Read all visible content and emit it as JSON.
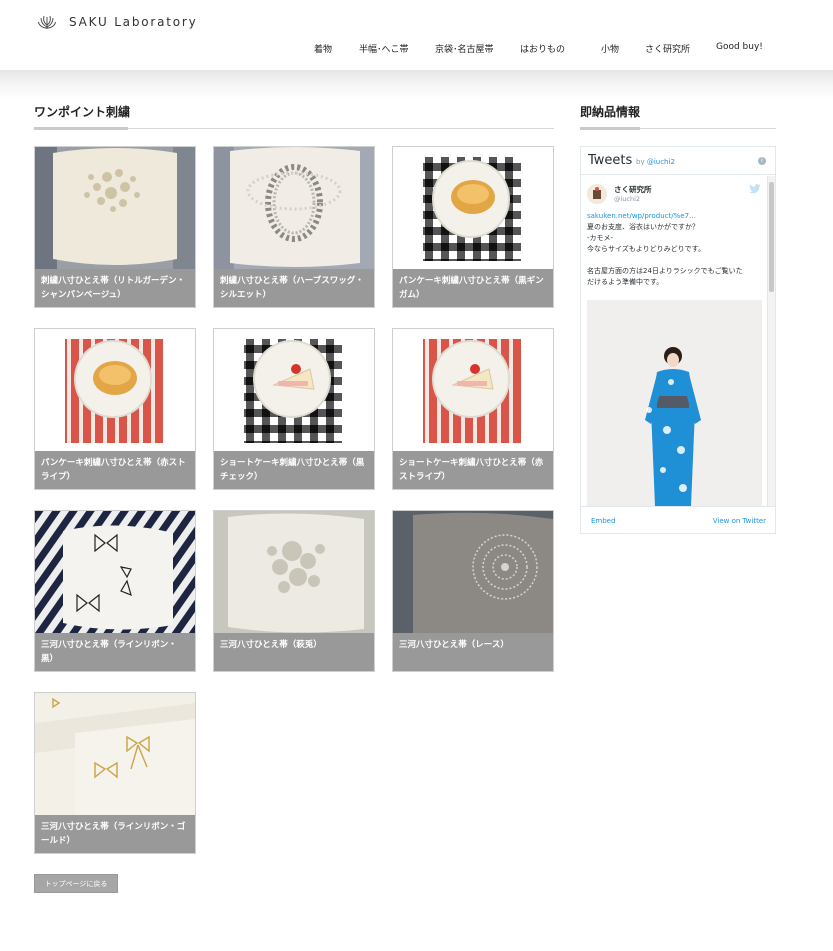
{
  "header": {
    "logo_text": "SAKU  Laboratory",
    "nav": [
      "着物",
      "半幅･へこ帯",
      "京袋･名古屋帯",
      "はおりもの",
      "小物",
      "さく研究所",
      "Good buy!"
    ]
  },
  "main": {
    "section_title": "ワンポイント刺繍",
    "products": [
      {
        "title": "刺繍八寸ひとえ帯（リトルガーデン・シャンパンベージュ）",
        "image": "embroidered-garden-obi"
      },
      {
        "title": "刺繍八寸ひとえ帯（ハーブスワッグ・シルエット）",
        "image": "herb-swag-wreath-obi"
      },
      {
        "title": "パンケーキ刺繍八寸ひとえ帯（黒ギンガム）",
        "image": "pancake-black-gingham-obi"
      },
      {
        "title": "パンケーキ刺繍八寸ひとえ帯（赤ストライプ）",
        "image": "pancake-red-stripe-obi"
      },
      {
        "title": "ショートケーキ刺繍八寸ひとえ帯（黒チェック）",
        "image": "shortcake-black-check-obi"
      },
      {
        "title": "ショートケーキ刺繍八寸ひとえ帯（赤ストライプ）",
        "image": "shortcake-red-stripe-obi"
      },
      {
        "title": "三河八寸ひとえ帯（ラインリボン・黒）",
        "image": "line-ribbon-black-obi"
      },
      {
        "title": "三河八寸ひとえ帯（萩兎）",
        "image": "hagi-usagi-obi"
      },
      {
        "title": "三河八寸ひとえ帯（レース）",
        "image": "lace-grey-obi"
      },
      {
        "title": "三河八寸ひとえ帯（ラインリボン・ゴールド）",
        "image": "line-ribbon-gold-obi"
      }
    ],
    "back_button": "トップページに戻る"
  },
  "sidebar": {
    "section_title": "即納品情報",
    "twitter": {
      "title": "Tweets",
      "by": "by",
      "by_handle": "@iuchi2",
      "tweet": {
        "name": "さく研究所",
        "handle": "@iuchi2",
        "lines": [
          "sakuken.net/wp/product/%e7…",
          "夏のお支度、浴衣はいかがですか？",
          "-カモメ-",
          "今ならサイズもよりどりみどりです。",
          "",
          "名古屋方面の方は24日よりラシックでもご覧いた",
          "だけるよう準備中です。"
        ]
      },
      "embed_label": "Embed",
      "view_label": "View on Twitter"
    }
  },
  "colors": {
    "caption_bg": "#999999",
    "link": "#1b95e0",
    "kimono_blue": "#1f8fd6"
  }
}
